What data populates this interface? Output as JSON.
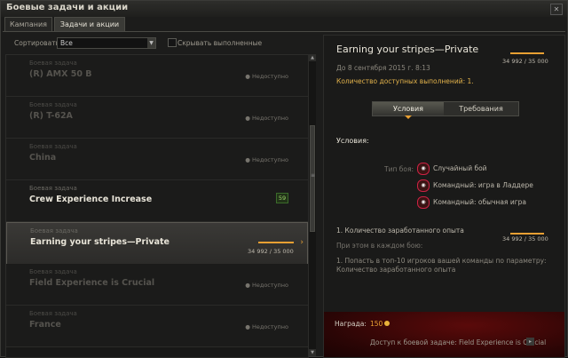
{
  "window": {
    "title": "Боевые задачи и акции"
  },
  "tabs": [
    {
      "label": "Кампания",
      "active": false
    },
    {
      "label": "Задачи и акции",
      "active": true
    }
  ],
  "filter": {
    "sort_label": "Сортировать:",
    "sort_value": "Все",
    "hide_label": "Скрывать выполненные",
    "hide_checked": false
  },
  "list": [
    {
      "category": "Боевая задача",
      "name": "(R) AMX 50 B",
      "status": "Недоступно",
      "enabled": false
    },
    {
      "category": "Боевая задача",
      "name": "(R) T-62A",
      "status": "Недоступно",
      "enabled": false
    },
    {
      "category": "Боевая задача",
      "name": "China",
      "status": "Недоступно",
      "enabled": false
    },
    {
      "category": "Боевая задача",
      "name": "Crew Experience Increase",
      "badge": "59",
      "enabled": true
    },
    {
      "category": "Боевая задача",
      "name": "Earning your stripes—Private",
      "progress_text": "34 992 / 35 000",
      "progress": 0.9998,
      "enabled": true,
      "selected": true
    },
    {
      "category": "Боевая задача",
      "name": "Field Experience is Crucial",
      "status": "Недоступно",
      "enabled": false
    },
    {
      "category": "Боевая задача",
      "name": "France",
      "status": "Недоступно",
      "enabled": false
    }
  ],
  "detail": {
    "title": "Earning your stripes—Private",
    "progress_text": "34 992 / 35 000",
    "progress": 0.9998,
    "date": "До 8 сентября 2015 г. 8:13",
    "count": "Количество доступных выполнений: 1.",
    "seg_conditions": "Условия",
    "seg_requirements": "Требования",
    "conditions_heading": "Условия:",
    "battle_type_label": "Тип боя:",
    "battle_types": [
      {
        "label": "Случайный бой",
        "icon": "random-battle-icon"
      },
      {
        "label": "Командный: игра в Ладдере",
        "icon": "ladder-battle-icon"
      },
      {
        "label": "Командный: обычная игра",
        "icon": "team-battle-icon"
      }
    ],
    "experience": "1. Количество заработанного опыта",
    "experience_progress_text": "34 992 / 35 000",
    "experience_progress": 0.9998,
    "each_battle": "При этом в каждом бою:",
    "req_line1": "1. Попасть в топ-10 игроков вашей команды по параметру:",
    "req_line2": "Количество заработанного опыта",
    "reward_label": "Награда:",
    "reward_value": "150",
    "access": "Доступ к боевой задаче: Field Experience is Crucial"
  },
  "colors": {
    "accent": "#e8a033",
    "reward_bg": "#5a0a0a"
  }
}
